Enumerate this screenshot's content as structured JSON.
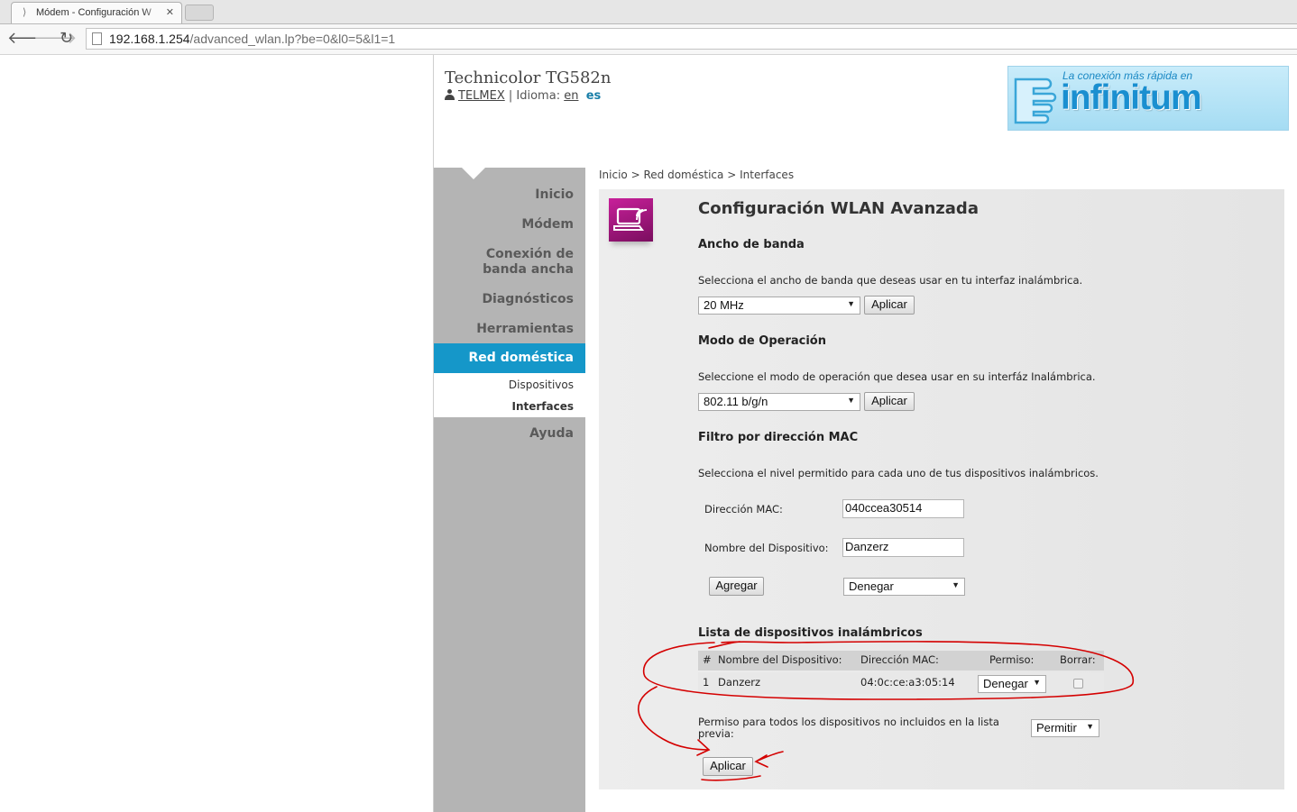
{
  "browser": {
    "tab_title": "Módem - Configuración W",
    "url_host": "192.168.1.254",
    "url_path": "/advanced_wlan.lp?be=0&l0=5&l1=1"
  },
  "header": {
    "product": "Technicolor TG582n",
    "user": "TELMEX",
    "separator": "|",
    "language_label": "Idioma:",
    "lang_en": "en",
    "lang_es": "es"
  },
  "banner": {
    "slogan": "La conexión más rápida en",
    "brand": "infinitum"
  },
  "sidebar": {
    "items": [
      {
        "label": "Inicio"
      },
      {
        "label": "Módem"
      },
      {
        "label": "Conexión de banda ancha"
      },
      {
        "label": "Diagnósticos"
      },
      {
        "label": "Herramientas"
      },
      {
        "label": "Red doméstica"
      },
      {
        "label": "Ayuda"
      }
    ],
    "subitems": [
      {
        "label": "Dispositivos"
      },
      {
        "label": "Interfaces"
      }
    ]
  },
  "breadcrumb": {
    "items": [
      "Inicio",
      "Red doméstica",
      "Interfaces"
    ],
    "separator": ">"
  },
  "main": {
    "title": "Configuración WLAN Avanzada",
    "bandwidth": {
      "heading": "Ancho de banda",
      "description": "Selecciona el ancho de banda que deseas usar en tu interfaz inalámbrica.",
      "selected": "20 MHz",
      "apply_label": "Aplicar"
    },
    "mode": {
      "heading": "Modo de Operación",
      "description": "Seleccione el modo de operación que desea usar en su interfáz Inalámbrica.",
      "selected": "802.11 b/g/n",
      "apply_label": "Aplicar"
    },
    "mac_filter": {
      "heading": "Filtro por dirección MAC",
      "description": "Selecciona el nivel permitido para cada uno de tus dispositivos inalámbricos.",
      "mac_label": "Dirección MAC:",
      "mac_value": "040ccea30514",
      "device_label": "Nombre del Dispositivo:",
      "device_value": "Danzerz",
      "add_label": "Agregar",
      "permission_selected": "Denegar"
    },
    "device_list": {
      "heading": "Lista de dispositivos inalámbricos",
      "columns": [
        "#",
        "Nombre del Dispositivo:",
        "Dirección MAC:",
        "Permiso:",
        "Borrar:"
      ],
      "rows": [
        {
          "index": "1",
          "name": "Danzerz",
          "mac": "04:0c:ce:a3:05:14",
          "permission": "Denegar",
          "delete": false
        }
      ]
    },
    "default_permission": {
      "label": "Permiso para todos los dispositivos no incluidos en la lista previa:",
      "selected": "Permitir"
    },
    "apply_label": "Aplicar"
  },
  "colors": {
    "active_menu": "#1597c9",
    "sidebar_bg": "#b4b4b4",
    "icon_magenta": "#b01b88",
    "annotation_red": "#d40000"
  }
}
